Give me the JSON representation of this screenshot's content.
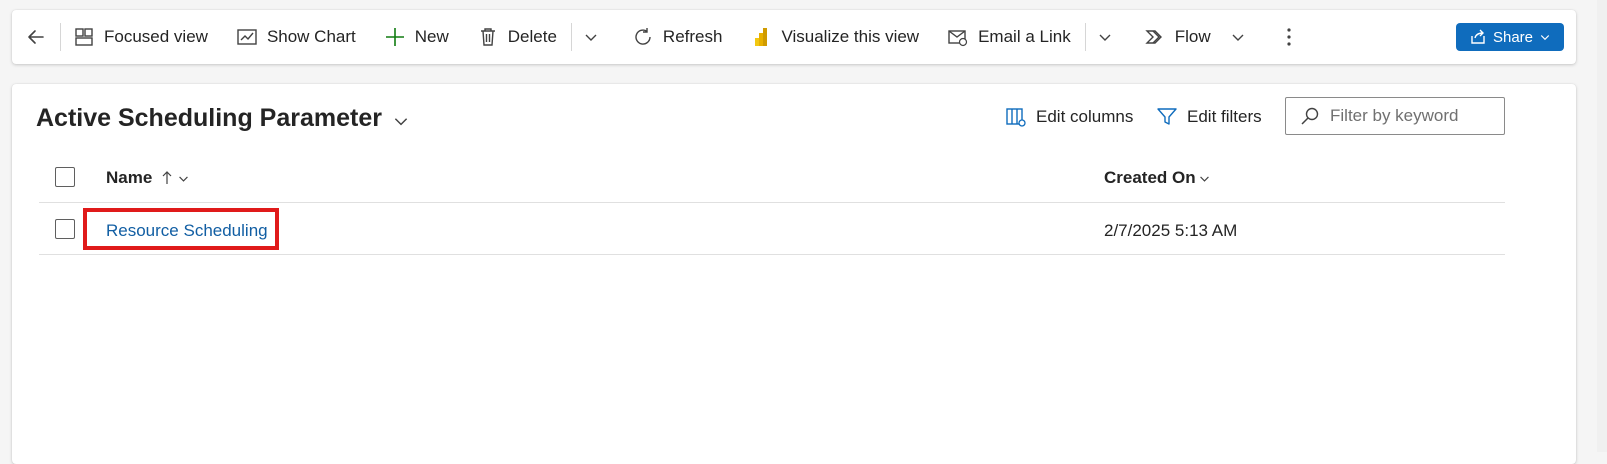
{
  "command_bar": {
    "back_icon": "back-arrow-icon",
    "items": {
      "focused_view": "Focused view",
      "show_chart": "Show Chart",
      "new": "New",
      "delete": "Delete",
      "refresh": "Refresh",
      "visualize": "Visualize this view",
      "email_link": "Email a Link",
      "flow": "Flow"
    },
    "share": "Share"
  },
  "view": {
    "title": "Active Scheduling Parameter",
    "edit_columns": "Edit columns",
    "edit_filters": "Edit filters",
    "filter_placeholder": "Filter by keyword"
  },
  "grid": {
    "columns": {
      "name": "Name",
      "created_on": "Created On"
    },
    "rows": [
      {
        "name": "Resource Scheduling",
        "created_on": "2/7/2025 5:13 AM"
      }
    ]
  },
  "colors": {
    "accent": "#0f6cbd",
    "link": "#115ea3",
    "highlight": "#e01a1a"
  }
}
